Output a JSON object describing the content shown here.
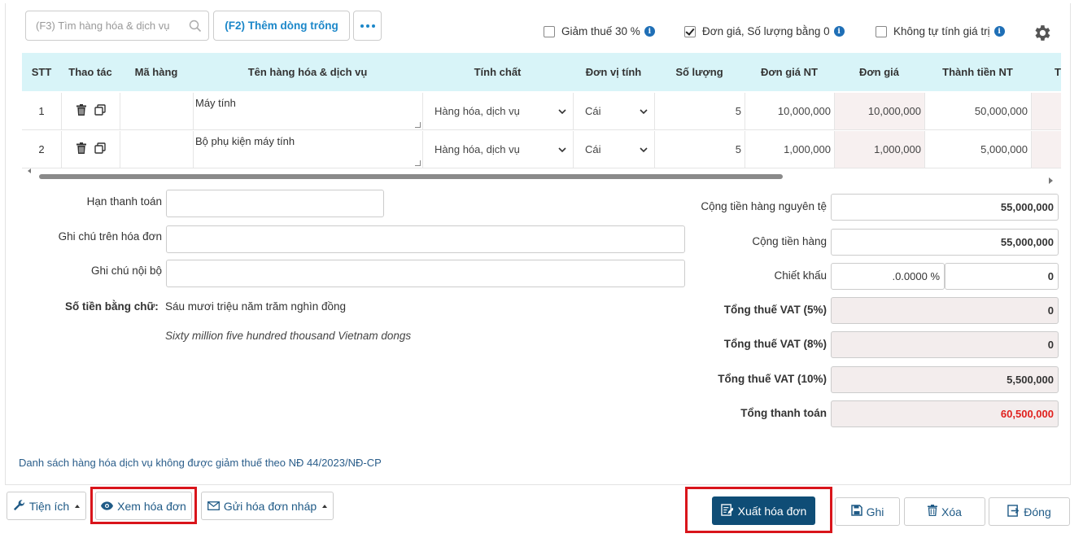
{
  "toolbar": {
    "search_placeholder": "(F3) Tìm hàng hóa & dịch vụ",
    "add_row_label": "(F2) Thêm dòng trống",
    "options": [
      {
        "label": "Giảm thuế 30 %",
        "checked": false
      },
      {
        "label": "Đơn giá, Số lượng bằng 0",
        "checked": true
      },
      {
        "label": "Không tự tính giá trị",
        "checked": false
      }
    ],
    "info_glyph": "i"
  },
  "table": {
    "headers": [
      "STT",
      "Thao tác",
      "Mã hàng",
      "Tên hàng hóa & dịch vụ",
      "Tính chất",
      "Đơn vị tính",
      "Số lượng",
      "Đơn giá NT",
      "Đơn giá",
      "Thành tiền NT",
      "T"
    ],
    "rows": [
      {
        "stt": "1",
        "code": "",
        "name": "Máy tính",
        "type": "Hàng hóa, dịch vụ",
        "unit": "Cái",
        "qty": "5",
        "price_nt": "10,000,000",
        "price": "10,000,000",
        "amount_nt": "50,000,000"
      },
      {
        "stt": "2",
        "code": "",
        "name": "Bộ phụ kiện máy tính",
        "type": "Hàng hóa, dịch vụ",
        "unit": "Cái",
        "qty": "5",
        "price_nt": "1,000,000",
        "price": "1,000,000",
        "amount_nt": "5,000,000"
      }
    ]
  },
  "form": {
    "due_label": "Hạn thanh toán",
    "note_invoice_label": "Ghi chú trên hóa đơn",
    "note_internal_label": "Ghi chú nội bộ",
    "amount_words_label": "Số tiền bằng chữ:",
    "amount_words_vi": "Sáu mươi triệu năm trăm nghìn đồng",
    "amount_words_en": "Sixty million five hundred thousand Vietnam dongs"
  },
  "totals": {
    "subtotal_fc_label": "Cộng tiền hàng nguyên tệ",
    "subtotal_fc": "55,000,000",
    "subtotal_label": "Cộng tiền hàng",
    "subtotal": "55,000,000",
    "discount_label": "Chiết khấu",
    "discount_pct": ".0.0000 %",
    "discount_amount": "0",
    "vat5_label": "Tổng thuế VAT (5%)",
    "vat5": "0",
    "vat8_label": "Tổng thuế VAT (8%)",
    "vat8": "0",
    "vat10_label": "Tổng thuế VAT (10%)",
    "vat10": "5,500,000",
    "grand_total_label": "Tổng thanh toán",
    "grand_total": "60,500,000"
  },
  "footnote": "Danh sách hàng hóa dịch vụ không được giảm thuế theo NĐ 44/2023/NĐ-CP",
  "footer": {
    "utilities": "Tiện ích",
    "view_invoice": "Xem hóa đơn",
    "send_draft": "Gửi hóa đơn nháp",
    "issue_invoice": "Xuất hóa đơn",
    "save": "Ghi",
    "delete": "Xóa",
    "close": "Đóng"
  },
  "colors": {
    "accent": "#1b87c9",
    "primary": "#0f4d76",
    "header_bg": "#d8f4f8",
    "highlight": "#d9151b",
    "total_red": "#e0201d"
  }
}
